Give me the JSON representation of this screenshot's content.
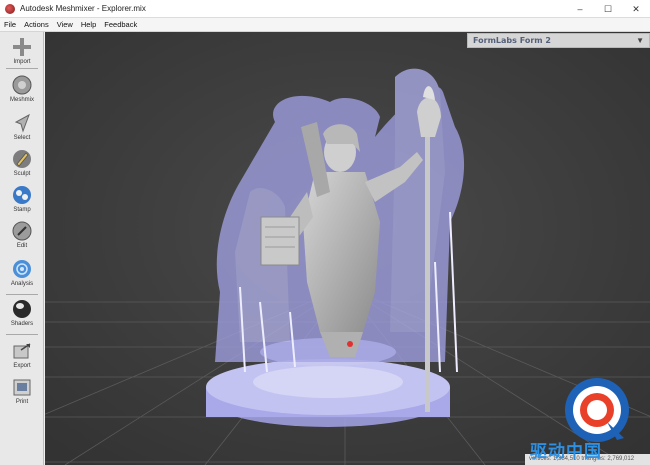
{
  "window": {
    "title": "Autodesk Meshmixer - Explorer.mix"
  },
  "window_controls": {
    "minimize": "–",
    "maximize": "☐",
    "close": "✕"
  },
  "menu": [
    "File",
    "Actions",
    "View",
    "Help",
    "Feedback"
  ],
  "tools": [
    {
      "label": "Import",
      "icon": "plus-icon"
    },
    {
      "label": "Meshmix",
      "icon": "meshmix-icon"
    },
    {
      "label": "Select",
      "icon": "select-arrow-icon"
    },
    {
      "label": "Sculpt",
      "icon": "sculpt-brush-icon"
    },
    {
      "label": "Stamp",
      "icon": "stamp-icon"
    },
    {
      "label": "Edit",
      "icon": "edit-icon"
    },
    {
      "label": "Analysis",
      "icon": "analysis-icon"
    },
    {
      "label": "Shaders",
      "icon": "shaders-icon"
    },
    {
      "label": "Export",
      "icon": "export-icon"
    },
    {
      "label": "Print",
      "icon": "print-icon"
    }
  ],
  "printer": {
    "name": "FormLabs Form 2"
  },
  "status": {
    "text": "vertices: 1,384,510  triangles: 2,769,012"
  },
  "watermark": {
    "text": "驱动中国"
  },
  "colors": {
    "viewport_bg": "#3c3c3c",
    "support_tint": "#a8a8ee",
    "model_gray": "#b5b5b5"
  }
}
